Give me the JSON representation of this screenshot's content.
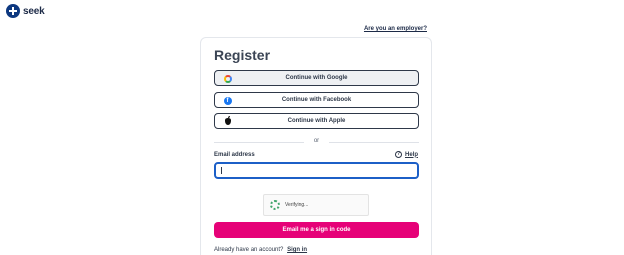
{
  "brand": {
    "name": "seek",
    "logo_icon": "seek-logo-icon"
  },
  "header": {
    "employer_link": "Are you an employer?"
  },
  "form": {
    "title": "Register",
    "social": {
      "google_label": "Continue with Google",
      "facebook_label": "Continue with Facebook",
      "apple_label": "Continue with Apple",
      "google_icon": "google-icon",
      "facebook_icon": "facebook-icon",
      "apple_icon": "apple-icon"
    },
    "divider_text": "or",
    "email": {
      "label": "Email address",
      "value": "",
      "placeholder": ""
    },
    "help_label": "Help",
    "captcha_status": "Verifying...",
    "submit_label": "Email me a sign in code",
    "signin_prompt": "Already have an account?",
    "signin_link": "Sign in"
  },
  "colors": {
    "primary": "#e60278",
    "brand": "#0d3880",
    "focus": "#1c5fc7",
    "text": "#2e3849"
  }
}
